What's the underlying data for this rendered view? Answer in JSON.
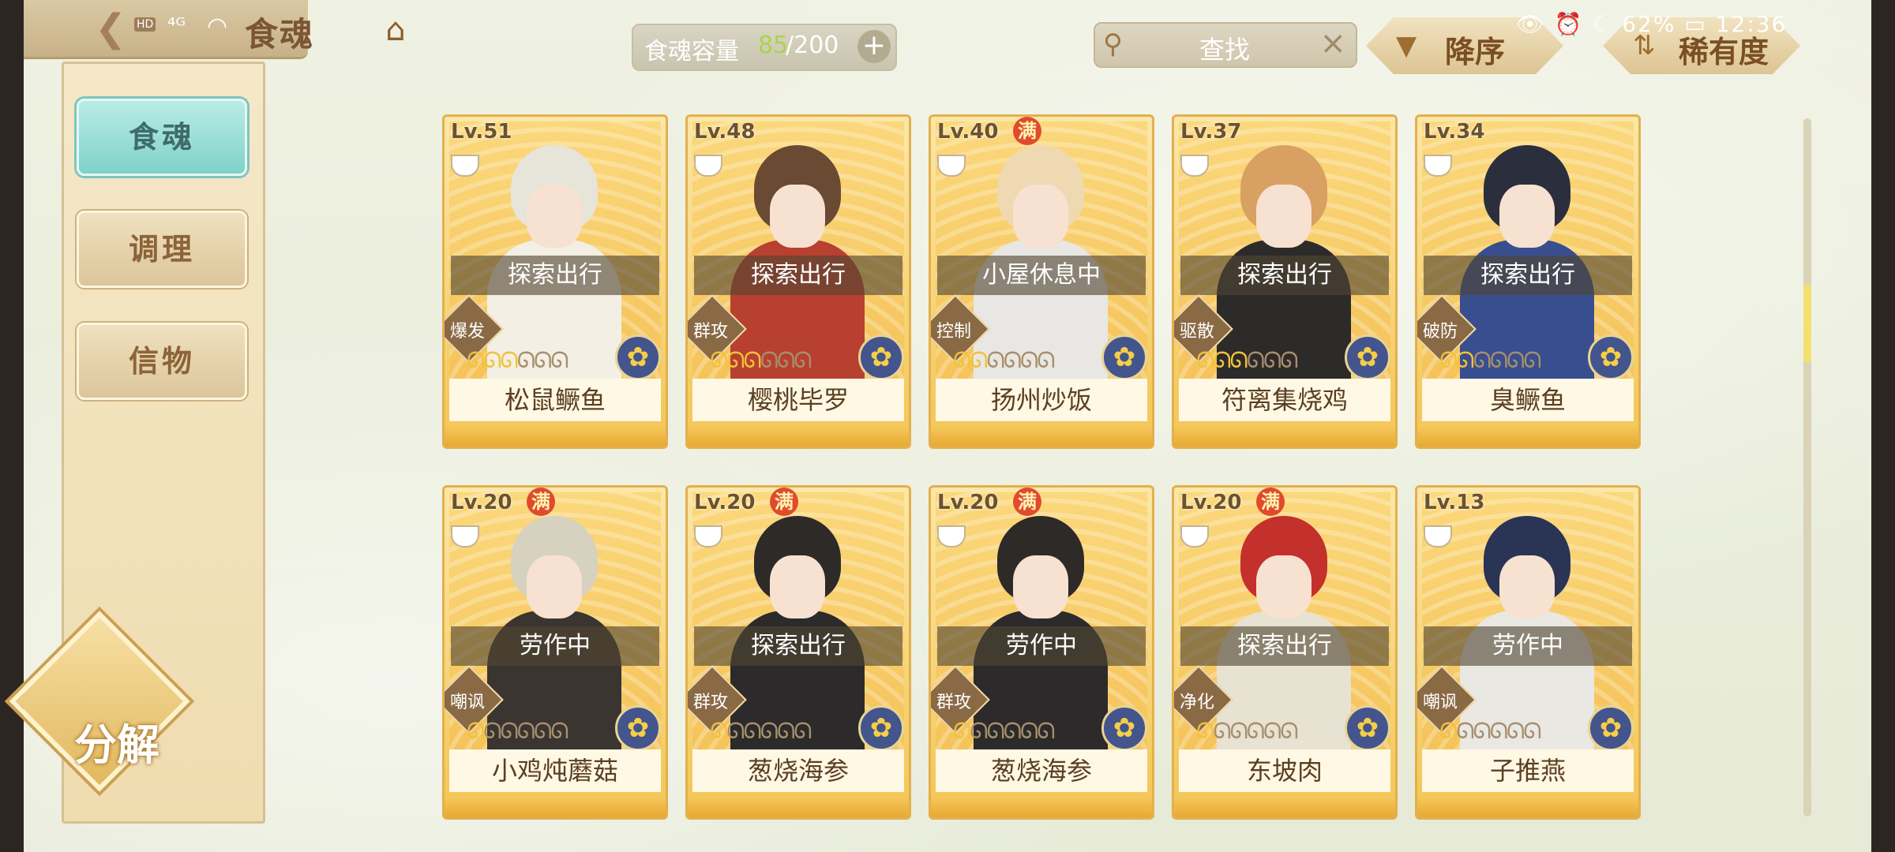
{
  "status_bar": {
    "hd": "HD",
    "signal": "⁴ᴳ",
    "battery": "62%",
    "time": "12:36",
    "icons": "👁 ⏰ ☾"
  },
  "header": {
    "title": "食魂"
  },
  "capacity": {
    "label": "食魂容量",
    "current": "85",
    "max": "/200",
    "plus": "+"
  },
  "search": {
    "placeholder": "查找",
    "clear": "×"
  },
  "sort": [
    {
      "label": "降序",
      "icon": "▼"
    },
    {
      "label": "稀有度",
      "icon": "⇅"
    }
  ],
  "side_menu": [
    {
      "label": "食魂",
      "active": true
    },
    {
      "label": "调理",
      "active": false
    },
    {
      "label": "信物",
      "active": false
    }
  ],
  "decompose_label": "分解",
  "full_badge_text": "满",
  "cards": [
    {
      "level": "Lv.51",
      "full": false,
      "state": "探索出行",
      "role": "爆发",
      "spirits_on": 3,
      "name": "松鼠鳜鱼",
      "hair": "#e7e4da",
      "outfit": "#f3efe4"
    },
    {
      "level": "Lv.48",
      "full": false,
      "state": "探索出行",
      "role": "群攻",
      "spirits_on": 3,
      "name": "樱桃毕罗",
      "hair": "#6a4a33",
      "outfit": "#b84030"
    },
    {
      "level": "Lv.40",
      "full": true,
      "state": "小屋休息中",
      "role": "控制",
      "spirits_on": 2,
      "name": "扬州炒饭",
      "hair": "#efd9b3",
      "outfit": "#e9e7e3"
    },
    {
      "level": "Lv.37",
      "full": false,
      "state": "探索出行",
      "role": "驱散",
      "spirits_on": 3,
      "name": "符离集烧鸡",
      "hair": "#d8a062",
      "outfit": "#2d2a2a"
    },
    {
      "level": "Lv.34",
      "full": false,
      "state": "探索出行",
      "role": "破防",
      "spirits_on": 2,
      "name": "臭鳜鱼",
      "hair": "#2b2f3d",
      "outfit": "#394e8e"
    },
    {
      "level": "Lv.20",
      "full": true,
      "state": "劳作中",
      "role": "嘲讽",
      "spirits_on": 1,
      "name": "小鸡炖蘑菇",
      "hair": "#d6d2bf",
      "outfit": "#3a3530"
    },
    {
      "level": "Lv.20",
      "full": true,
      "state": "探索出行",
      "role": "群攻",
      "spirits_on": 1,
      "name": "葱烧海参",
      "hair": "#2e2a28",
      "outfit": "#2c2a2b"
    },
    {
      "level": "Lv.20",
      "full": true,
      "state": "劳作中",
      "role": "群攻",
      "spirits_on": 1,
      "name": "葱烧海参",
      "hair": "#2e2a28",
      "outfit": "#2c2a2b"
    },
    {
      "level": "Lv.20",
      "full": true,
      "state": "探索出行",
      "role": "净化",
      "spirits_on": 1,
      "name": "东坡肉",
      "hair": "#c4302c",
      "outfit": "#e8e2d3"
    },
    {
      "level": "Lv.13",
      "full": false,
      "state": "劳作中",
      "role": "嘲讽",
      "spirits_on": 1,
      "name": "子推燕",
      "hair": "#2a3454",
      "outfit": "#eae8e3"
    }
  ]
}
